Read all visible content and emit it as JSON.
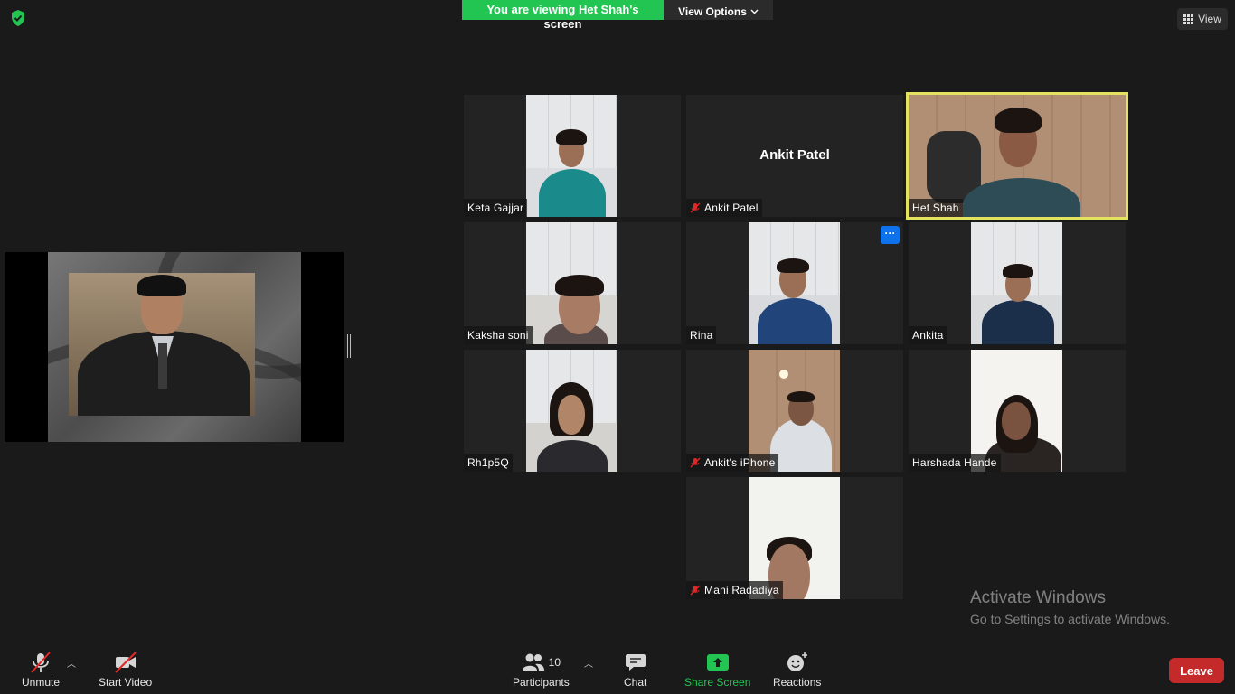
{
  "banner": {
    "viewing_text": "You are viewing Het Shah's screen",
    "view_options_label": "View Options"
  },
  "top_right": {
    "view_label": "View"
  },
  "tiles": [
    {
      "name": "Keta Gajjar",
      "muted": false
    },
    {
      "name": "Ankit Patel",
      "muted": true,
      "center_name": "Ankit Patel"
    },
    {
      "name": "Het Shah",
      "muted": false,
      "active_speaker": true
    },
    {
      "name": "Kaksha soni",
      "muted": false
    },
    {
      "name": "Rina",
      "muted": false,
      "more_label": "···"
    },
    {
      "name": "Ankita",
      "muted": false
    },
    {
      "name": "Rh1p5Q",
      "muted": false
    },
    {
      "name": "Ankit's iPhone",
      "muted": true
    },
    {
      "name": "Harshada Hande",
      "muted": false
    },
    {
      "name": "Mani Radadiya",
      "muted": true
    }
  ],
  "watermark": {
    "line1": "Activate Windows",
    "line2": "Go to Settings to activate Windows."
  },
  "toolbar": {
    "unmute_label": "Unmute",
    "start_video_label": "Start Video",
    "participants_label": "Participants",
    "participants_count": "10",
    "chat_label": "Chat",
    "share_screen_label": "Share Screen",
    "reactions_label": "Reactions",
    "leave_label": "Leave"
  },
  "colors": {
    "accent_green": "#23c552",
    "active_speaker_border": "#e3e35f",
    "leave_red": "#c52a2a",
    "more_blue": "#0e72ed",
    "muted_red": "#e02828"
  }
}
